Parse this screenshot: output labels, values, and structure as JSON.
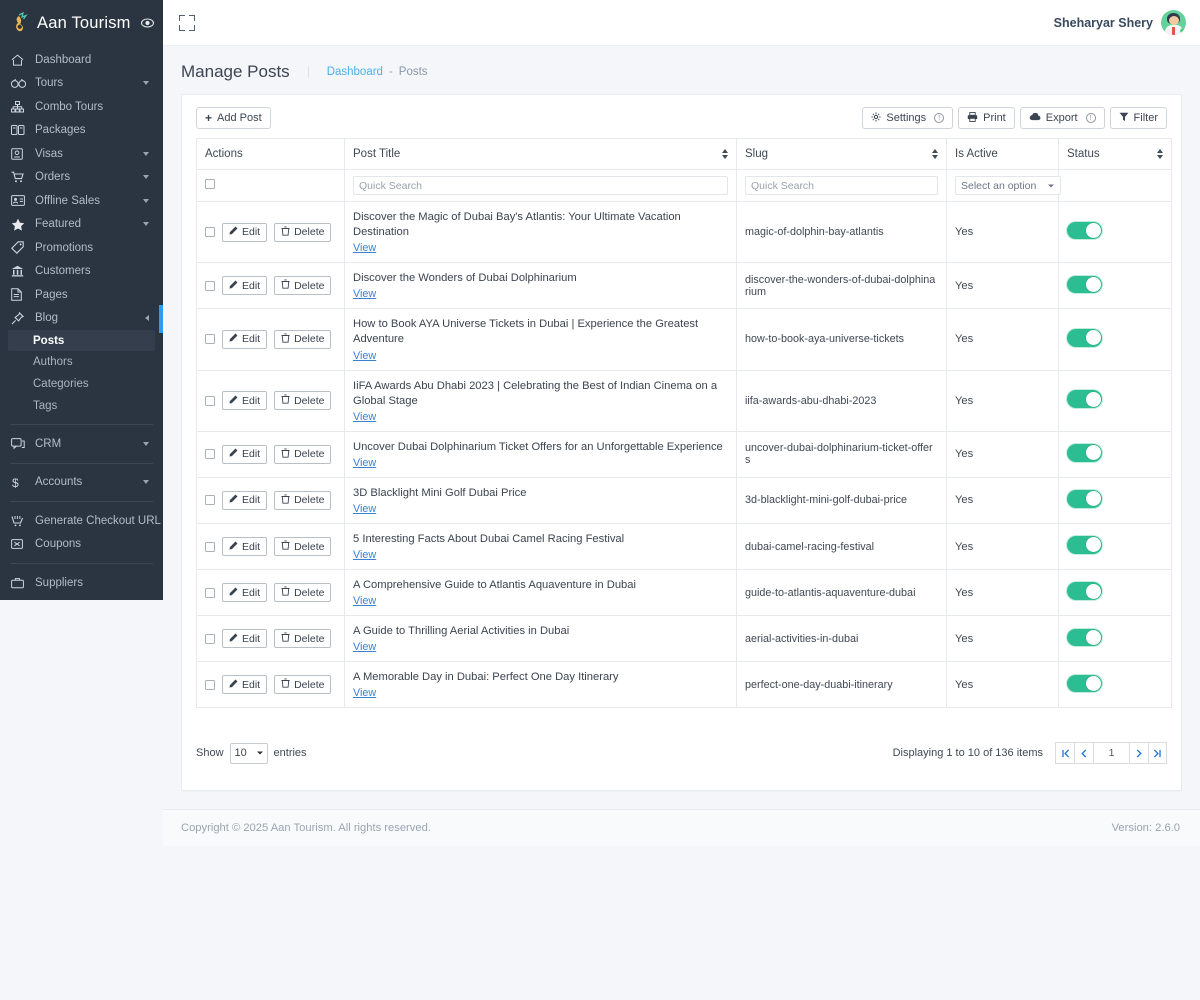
{
  "brand": {
    "name": "Aan Tourism",
    "logo_icon": "bird-logo-icon",
    "eye_icon": "eye-icon"
  },
  "topbar": {
    "expand_icon": "fullscreen-expand-icon",
    "user_name": "Sheharyar Shery",
    "avatar_icon": "user-avatar"
  },
  "sidebar": {
    "items": [
      {
        "label": "Dashboard",
        "icon": "home-icon",
        "caret": false
      },
      {
        "label": "Tours",
        "icon": "binoculars-icon",
        "caret": true
      },
      {
        "label": "Combo Tours",
        "icon": "sitemap-icon",
        "caret": false
      },
      {
        "label": "Packages",
        "icon": "packages-icon",
        "caret": false
      },
      {
        "label": "Visas",
        "icon": "passport-icon",
        "caret": true
      },
      {
        "label": "Orders",
        "icon": "cart-icon",
        "caret": true
      },
      {
        "label": "Offline Sales",
        "icon": "id-card-icon",
        "caret": true
      },
      {
        "label": "Featured",
        "icon": "star-icon",
        "caret": true
      },
      {
        "label": "Promotions",
        "icon": "tag-icon",
        "caret": false
      },
      {
        "label": "Customers",
        "icon": "bank-icon",
        "caret": false
      },
      {
        "label": "Pages",
        "icon": "file-icon",
        "caret": false
      },
      {
        "label": "Blog",
        "icon": "pin-icon",
        "caret": false,
        "open": true
      }
    ],
    "blog_sub": [
      {
        "label": "Posts",
        "active": true
      },
      {
        "label": "Authors",
        "active": false
      },
      {
        "label": "Categories",
        "active": false
      },
      {
        "label": "Tags",
        "active": false
      }
    ],
    "group2": [
      {
        "label": "CRM",
        "icon": "chat-icon",
        "caret": true
      }
    ],
    "group3": [
      {
        "label": "Accounts",
        "icon": "dollar-icon",
        "caret": true
      }
    ],
    "group4": [
      {
        "label": "Generate Checkout URL",
        "icon": "checkout-cart-icon",
        "caret": false
      },
      {
        "label": "Coupons",
        "icon": "coupon-icon",
        "caret": false
      }
    ],
    "group5": [
      {
        "label": "Suppliers",
        "icon": "briefcase-icon",
        "caret": false
      }
    ]
  },
  "page": {
    "title": "Manage Posts",
    "breadcrumb": {
      "root": "Dashboard",
      "separator": "-",
      "current": "Posts"
    }
  },
  "toolbar": {
    "add_label": "Add Post",
    "add_icon": "plus-icon",
    "settings_label": "Settings",
    "settings_icon": "gear-icon",
    "print_label": "Print",
    "print_icon": "printer-icon",
    "export_label": "Export",
    "export_icon": "cloud-icon",
    "filter_label": "Filter",
    "filter_icon": "funnel-icon",
    "info_glyph": "!"
  },
  "table": {
    "columns": [
      {
        "label": "Actions",
        "sortable": false
      },
      {
        "label": "Post Title",
        "sortable": true
      },
      {
        "label": "Slug",
        "sortable": true
      },
      {
        "label": "Is Active",
        "sortable": false
      },
      {
        "label": "Status",
        "sortable": true
      }
    ],
    "filters": {
      "title_placeholder": "Quick Search",
      "slug_placeholder": "Quick Search",
      "is_active_placeholder": "Select an option"
    },
    "row_actions": {
      "edit": "Edit",
      "delete": "Delete",
      "view": "View"
    },
    "rows": [
      {
        "title": "Discover the Magic of Dubai Bay's Atlantis: Your Ultimate Vacation Destination",
        "slug": "magic-of-dolphin-bay-atlantis",
        "is_active": "Yes",
        "status_on": true
      },
      {
        "title": "Discover the Wonders of Dubai Dolphinarium",
        "slug": "discover-the-wonders-of-dubai-dolphinarium",
        "is_active": "Yes",
        "status_on": true
      },
      {
        "title": "How to Book AYA Universe Tickets in Dubai | Experience the Greatest Adventure",
        "slug": "how-to-book-aya-universe-tickets",
        "is_active": "Yes",
        "status_on": true
      },
      {
        "title": "IiFA Awards Abu Dhabi 2023 | Celebrating the Best of Indian Cinema on a Global Stage",
        "slug": "iifa-awards-abu-dhabi-2023",
        "is_active": "Yes",
        "status_on": true
      },
      {
        "title": "Uncover Dubai Dolphinarium Ticket Offers for an Unforgettable Experience",
        "slug": "uncover-dubai-dolphinarium-ticket-offers",
        "is_active": "Yes",
        "status_on": true
      },
      {
        "title": "3D Blacklight Mini Golf Dubai Price",
        "slug": "3d-blacklight-mini-golf-dubai-price",
        "is_active": "Yes",
        "status_on": true
      },
      {
        "title": "5 Interesting Facts About Dubai Camel Racing Festival",
        "slug": "dubai-camel-racing-festival",
        "is_active": "Yes",
        "status_on": true
      },
      {
        "title": "A Comprehensive Guide to Atlantis Aquaventure in Dubai",
        "slug": "guide-to-atlantis-aquaventure-dubai",
        "is_active": "Yes",
        "status_on": true
      },
      {
        "title": "A Guide to Thrilling Aerial Activities in Dubai",
        "slug": "aerial-activities-in-dubai",
        "is_active": "Yes",
        "status_on": true
      },
      {
        "title": "A Memorable Day in Dubai: Perfect One Day Itinerary",
        "slug": "perfect-one-day-duabi-itinerary",
        "is_active": "Yes",
        "status_on": true
      }
    ]
  },
  "footer_controls": {
    "show_label": "Show",
    "entries_label": "entries",
    "page_size": "10",
    "display_info": "Displaying 1 to 10 of 136 items",
    "current_page": "1",
    "first_icon": "first-page-icon",
    "prev_icon": "prev-page-icon",
    "next_icon": "next-page-icon",
    "last_icon": "last-page-icon"
  },
  "page_footer": {
    "copyright": "Copyright © 2025 Aan Tourism. All rights reserved.",
    "version": "Version: 2.6.0"
  },
  "colors": {
    "sidebar_bg": "#2b3441",
    "toggle_on": "#2dbd93",
    "link": "#4fb0e8",
    "marker": "#2e9bf0"
  }
}
